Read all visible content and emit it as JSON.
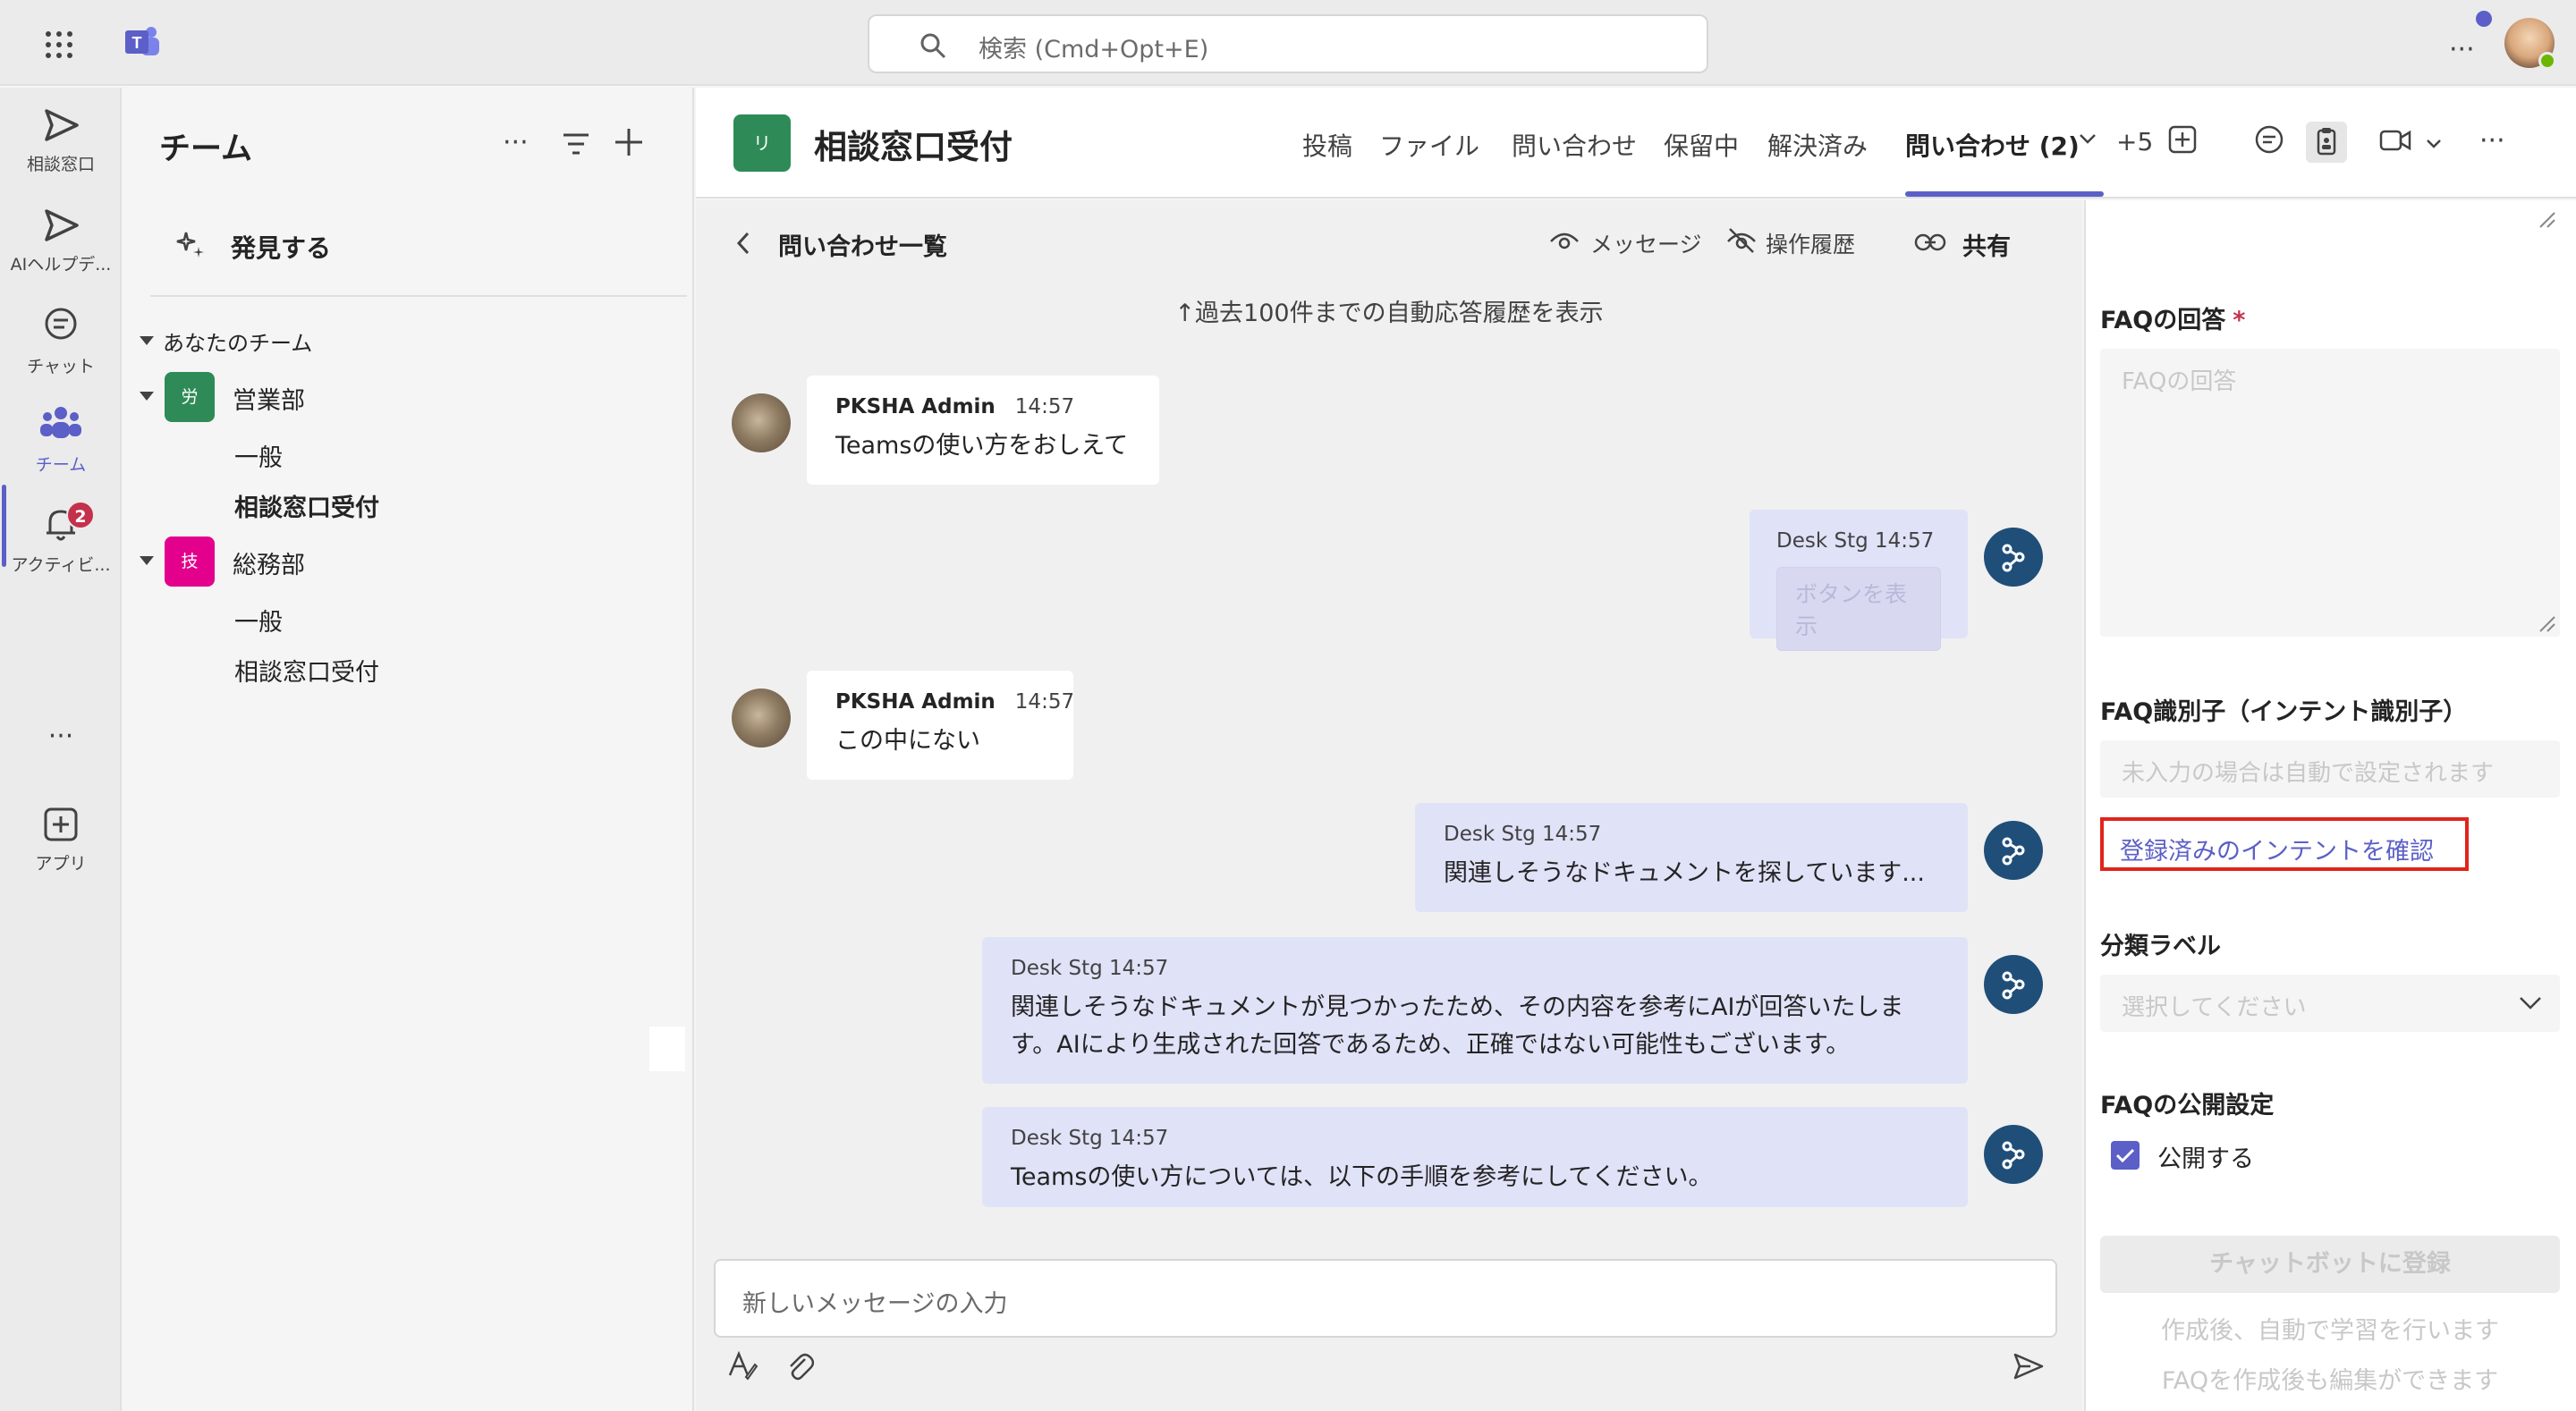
{
  "search": {
    "placeholder": "検索 (Cmd+Opt+E)"
  },
  "rail": {
    "items": [
      {
        "label": "相談窓口"
      },
      {
        "label": "AIヘルプデ..."
      },
      {
        "label": "チャット"
      },
      {
        "label": "チーム"
      },
      {
        "label": "アクティビ..."
      },
      {
        "label": "アプリ"
      }
    ],
    "activity_badge": "2"
  },
  "teams_panel": {
    "title": "チーム",
    "discover": "発見する",
    "your_teams": "あなたのチーム",
    "teams": [
      {
        "avatar": "労",
        "name": "営業部",
        "color": "#2e8b57",
        "channels": [
          "一般",
          "相談窓口受付"
        ]
      },
      {
        "avatar": "技",
        "name": "総務部",
        "color": "#e3008c",
        "channels": [
          "一般",
          "相談窓口受付"
        ]
      }
    ]
  },
  "channel_header": {
    "avatar": "リ",
    "title": "相談窓口受付",
    "tabs": [
      "投稿",
      "ファイル",
      "問い合わせ",
      "保留中",
      "解決済み",
      "問い合わせ (2)",
      "+5"
    ]
  },
  "subheader": {
    "back_label": "問い合わせ一覧",
    "messages": "メッセージ",
    "history": "操作履歴",
    "share": "共有"
  },
  "history_link": "↑過去100件までの自動応答履歴を表示",
  "messages": [
    {
      "author": "PKSHA Admin",
      "time": "14:57",
      "text": "Teamsの使い方をおしえて"
    },
    {
      "author": "Desk Stg",
      "time": "14:57",
      "button": "ボタンを表示"
    },
    {
      "author": "PKSHA Admin",
      "time": "14:57",
      "text": "この中にない"
    },
    {
      "author": "Desk Stg",
      "time": "14:57",
      "text": "関連しそうなドキュメントを探しています..."
    },
    {
      "author": "Desk Stg",
      "time": "14:57",
      "text": "関連しそうなドキュメントが見つかったため、その内容を参考にAIが回答いたします。AIにより生成された回答であるため、正確ではない可能性もございます。"
    },
    {
      "author": "Desk Stg",
      "time": "14:57",
      "text": "Teamsの使い方については、以下の手順を参考にしてください。"
    }
  ],
  "compose": {
    "placeholder": "新しいメッセージの入力"
  },
  "right_panel": {
    "faq_answer_label": "FAQの回答",
    "faq_answer_required": "*",
    "faq_answer_placeholder": "FAQの回答",
    "faq_id_label": "FAQ識別子（インテント識別子）",
    "faq_id_placeholder": "未入力の場合は自動で設定されます",
    "intent_link": "登録済みのインテントを確認",
    "category_label": "分類ラベル",
    "category_placeholder": "選択してください",
    "publish_label": "FAQの公開設定",
    "publish_checkbox": "公開する",
    "publish_checked": true,
    "submit": "チャットボットに登録",
    "note1": "作成後、自動で学習を行います",
    "note2": "FAQを作成後も編集ができます"
  },
  "colors": {
    "accent": "#5b5fc7",
    "highlight_border": "#e0241b",
    "bot_avatar": "#1f4e79"
  }
}
